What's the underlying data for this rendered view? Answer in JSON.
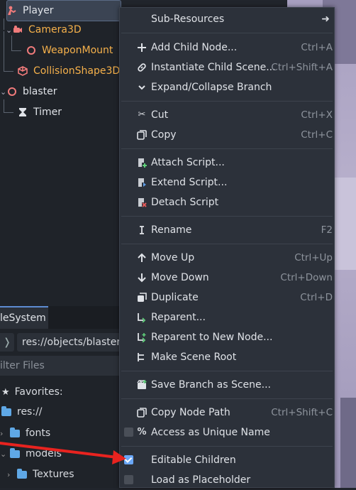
{
  "scene_tree": {
    "nodes": [
      {
        "label": "Player",
        "icon": "character-body-icon"
      },
      {
        "label": "Camera3D",
        "icon": "camera-icon"
      },
      {
        "label": "WeaponMount",
        "icon": "node3d-icon"
      },
      {
        "label": "CollisionShape3D",
        "icon": "collision-shape-icon"
      },
      {
        "label": "blaster",
        "icon": "node3d-icon"
      },
      {
        "label": "Timer",
        "icon": "timer-icon"
      }
    ]
  },
  "filesystem": {
    "tab_label": "leSystem",
    "back_glyph": "❭",
    "path": "res://objects/blaster.t",
    "filter_placeholder": "ilter Files",
    "favorites_label": "Favorites:",
    "items": [
      {
        "label": "res://"
      },
      {
        "label": "fonts"
      },
      {
        "label": "models"
      },
      {
        "label": "Textures"
      }
    ]
  },
  "context_menu": {
    "sub_resources": "Sub-Resources",
    "items": [
      {
        "label": "Add Child Node...",
        "shortcut": "Ctrl+A",
        "icon": "add-icon"
      },
      {
        "label": "Instantiate Child Scene...",
        "shortcut": "Ctrl+Shift+A",
        "icon": "link-icon"
      },
      {
        "label": "Expand/Collapse Branch",
        "shortcut": "",
        "icon": "chevron-down-icon"
      },
      {
        "label": "Cut",
        "shortcut": "Ctrl+X",
        "icon": "scissors-icon"
      },
      {
        "label": "Copy",
        "shortcut": "Ctrl+C",
        "icon": "copy-icon"
      },
      {
        "label": "Attach Script...",
        "shortcut": "",
        "icon": "script-add-icon"
      },
      {
        "label": "Extend Script...",
        "shortcut": "",
        "icon": "script-extend-icon"
      },
      {
        "label": "Detach Script",
        "shortcut": "",
        "icon": "script-remove-icon"
      },
      {
        "label": "Rename",
        "shortcut": "F2",
        "icon": "rename-icon"
      },
      {
        "label": "Move Up",
        "shortcut": "Ctrl+Up",
        "icon": "arrow-up-icon"
      },
      {
        "label": "Move Down",
        "shortcut": "Ctrl+Down",
        "icon": "arrow-down-icon"
      },
      {
        "label": "Duplicate",
        "shortcut": "Ctrl+D",
        "icon": "duplicate-icon"
      },
      {
        "label": "Reparent...",
        "shortcut": "",
        "icon": "reparent-icon"
      },
      {
        "label": "Reparent to New Node...",
        "shortcut": "",
        "icon": "reparent-new-icon"
      },
      {
        "label": "Make Scene Root",
        "shortcut": "",
        "icon": "scene-root-icon"
      },
      {
        "label": "Save Branch as Scene...",
        "shortcut": "",
        "icon": "save-branch-icon"
      },
      {
        "label": "Copy Node Path",
        "shortcut": "Ctrl+Shift+C",
        "icon": "copy-path-icon"
      },
      {
        "label": "Access as Unique Name",
        "shortcut": "",
        "icon": "percent-icon",
        "checked": false
      },
      {
        "label": "Editable Children",
        "shortcut": "",
        "checked": true
      },
      {
        "label": "Load as Placeholder",
        "shortcut": "",
        "checked": false
      }
    ]
  },
  "colors": {
    "menu_bg": "#2c313a",
    "accent": "#6aa7f8",
    "node_text_orange": "#f6b14b",
    "annotation_arrow": "#e8231f"
  }
}
